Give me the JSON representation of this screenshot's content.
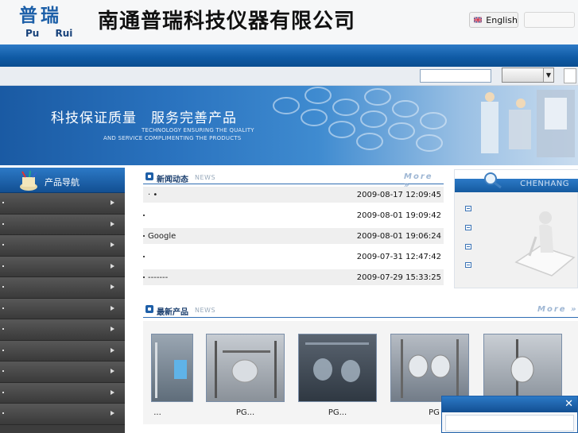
{
  "header": {
    "logo_cn": "普瑞",
    "logo_en": "Pu Rui",
    "company": "南通普瑞科技仪器有限公司",
    "language_label": "English"
  },
  "banner": {
    "slogan": "科技保证质量　服务完善产品",
    "sub_line1": "TECHNOLOGY ENSURING THE QUALITY",
    "sub_line2": "AND SERVICE COMPLIMENTING THE PRODUCTS"
  },
  "sidebar": {
    "title": "产品导航",
    "item_count_visible": 11
  },
  "news": {
    "title": "新闻动态",
    "tag": "NEWS",
    "more": "More »",
    "items": [
      {
        "title": "·  •",
        "date": "2009-08-17 12:09:45"
      },
      {
        "title": "",
        "date": "2009-08-01 19:09:42"
      },
      {
        "title": "       Google",
        "date": "2009-08-01 19:06:24"
      },
      {
        "title": "",
        "date": "2009-07-31 12:47:42"
      },
      {
        "title": "        -------",
        "date": "2009-07-29 15:33:25"
      }
    ]
  },
  "right": {
    "tag": "CHENHANG"
  },
  "products": {
    "title": "最新产品",
    "tag": "NEWS",
    "more": "More »",
    "items": [
      {
        "label": "..."
      },
      {
        "label": "PG..."
      },
      {
        "label": "PG..."
      },
      {
        "label": "PG"
      },
      {
        "label": ""
      }
    ]
  },
  "popup": {
    "close": "✕"
  },
  "colors": {
    "brand_blue": "#1c5fa8",
    "nav_blue": "#0f5aa4",
    "sidebar_dark": "#3d3d3d"
  }
}
